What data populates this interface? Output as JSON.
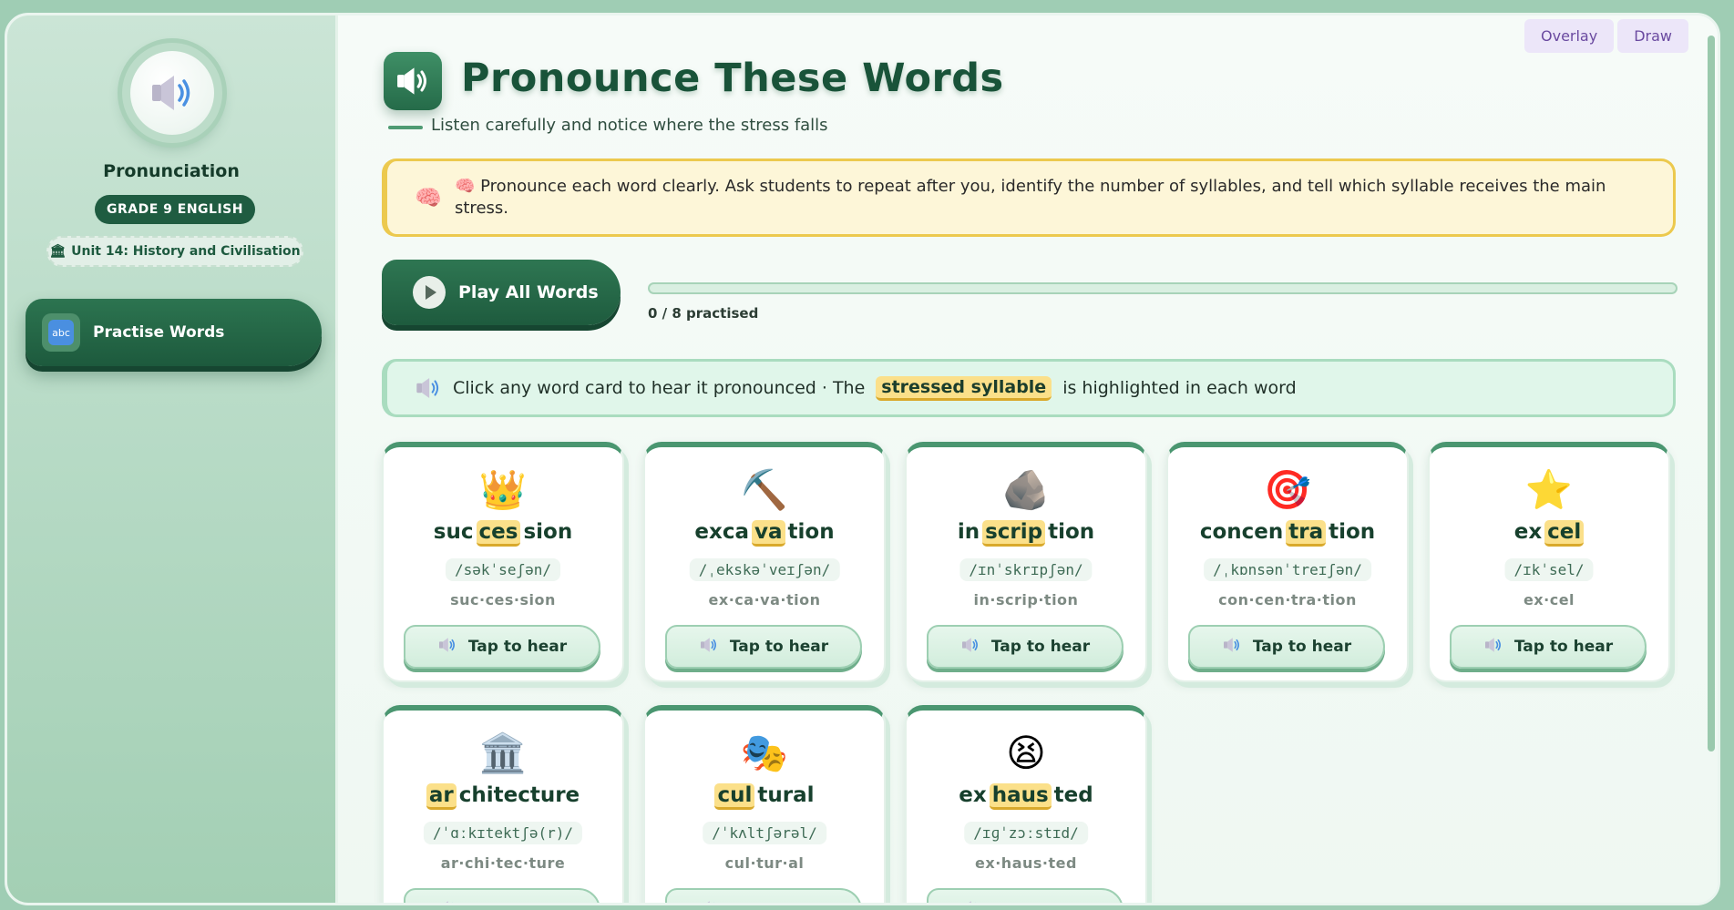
{
  "top_buttons": {
    "overlay": "Overlay",
    "draw": "Draw"
  },
  "sidebar": {
    "logo_icon": "speaker-icon",
    "title": "Pronunciation",
    "grade": "GRADE 9 ENGLISH",
    "unit_icon": "🏛",
    "unit": "Unit 14: History and Civilisation",
    "nav": [
      {
        "icon": "abc",
        "label": "Practise Words"
      }
    ]
  },
  "header": {
    "title": "Pronounce These Words",
    "subtitle": "Listen carefully and notice where the stress falls"
  },
  "note": {
    "icon": "🧠",
    "text": "🧠 Pronounce each word clearly. Ask students to repeat after you, identify the number of syllables, and tell which syllable receives the main stress."
  },
  "controls": {
    "play_all": "Play All Words",
    "progress_text": "0 / 8 practised",
    "progress_fraction": 0
  },
  "hint": {
    "before": "Click any word card to hear it pronounced · The",
    "chip": "stressed syllable",
    "after": "is highlighted in each word"
  },
  "tap_label": "Tap to hear",
  "words": [
    {
      "emoji": "👑",
      "pre": "suc",
      "stress": "ces",
      "post": "sion",
      "ipa": "/səkˈseʃən/",
      "syllables": "suc·ces·sion"
    },
    {
      "emoji": "⛏️",
      "pre": "exca",
      "stress": "va",
      "post": "tion",
      "ipa": "/ˌekskəˈveɪʃən/",
      "syllables": "ex·ca·va·tion"
    },
    {
      "emoji": "🪨",
      "pre": "in",
      "stress": "scrip",
      "post": "tion",
      "ipa": "/ɪnˈskrɪpʃən/",
      "syllables": "in·scrip·tion"
    },
    {
      "emoji": "🎯",
      "pre": "concen",
      "stress": "tra",
      "post": "tion",
      "ipa": "/ˌkɒnsənˈtreɪʃən/",
      "syllables": "con·cen·tra·tion"
    },
    {
      "emoji": "⭐",
      "pre": "ex",
      "stress": "cel",
      "post": "",
      "ipa": "/ɪkˈsel/",
      "syllables": "ex·cel"
    },
    {
      "emoji": "🏛️",
      "pre": "",
      "stress": "ar",
      "post": "chitecture",
      "ipa": "/ˈɑːkɪtektʃə(r)/",
      "syllables": "ar·chi·tec·ture"
    },
    {
      "emoji": "🎭",
      "pre": "",
      "stress": "cul",
      "post": "tural",
      "ipa": "/ˈkʌltʃərəl/",
      "syllables": "cul·tur·al"
    },
    {
      "emoji": "😫",
      "pre": "ex",
      "stress": "haus",
      "post": "ted",
      "ipa": "/ɪɡˈzɔːstɪd/",
      "syllables": "ex·haus·ted"
    }
  ]
}
